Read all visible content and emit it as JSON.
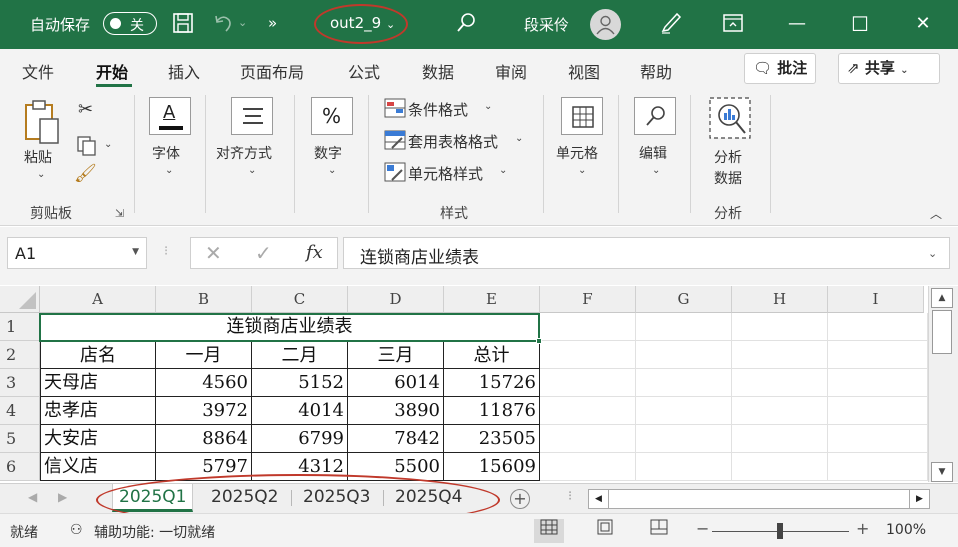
{
  "titlebar": {
    "autosave_label": "自动保存",
    "autosave_state": "关",
    "filename": "out2_9",
    "username": "段采伶",
    "min": "—",
    "max": "☐",
    "close": "✕"
  },
  "menu": {
    "items": [
      "文件",
      "开始",
      "插入",
      "页面布局",
      "公式",
      "数据",
      "审阅",
      "视图",
      "帮助"
    ],
    "active": "开始",
    "comments_btn": "批注",
    "share_btn": "共享"
  },
  "ribbon": {
    "clipboard": {
      "paste": "粘贴",
      "group": "剪贴板"
    },
    "font": "字体",
    "alignment": "对齐方式",
    "number": "数字",
    "styles": {
      "conditional": "条件格式",
      "table_format": "套用表格格式",
      "cell_styles": "单元格样式",
      "group": "样式"
    },
    "cells": "单元格",
    "editing": "编辑",
    "analysis": {
      "button": "分析\n数据",
      "line1": "分析",
      "line2": "数据",
      "group": "分析"
    }
  },
  "formula_bar": {
    "name_box": "A1",
    "fx": "fx",
    "content": "连锁商店业绩表"
  },
  "sheet": {
    "columns": [
      "A",
      "B",
      "C",
      "D",
      "E",
      "F",
      "G",
      "H",
      "I"
    ],
    "rows": [
      "1",
      "2",
      "3",
      "4",
      "5",
      "6"
    ],
    "title": "连锁商店业绩表",
    "headers": [
      "店名",
      "一月",
      "二月",
      "三月",
      "总计"
    ],
    "data": [
      [
        "天母店",
        "4560",
        "5152",
        "6014",
        "15726"
      ],
      [
        "忠孝店",
        "3972",
        "4014",
        "3890",
        "11876"
      ],
      [
        "大安店",
        "8864",
        "6799",
        "7842",
        "23505"
      ],
      [
        "信义店",
        "5797",
        "4312",
        "5500",
        "15609"
      ]
    ]
  },
  "tabs": {
    "items": [
      "2025Q1",
      "2025Q2",
      "2025Q3",
      "2025Q4"
    ],
    "active": "2025Q1",
    "add": "+"
  },
  "status": {
    "ready": "就绪",
    "accessibility": "辅助功能: 一切就绪",
    "zoom": "100%"
  }
}
